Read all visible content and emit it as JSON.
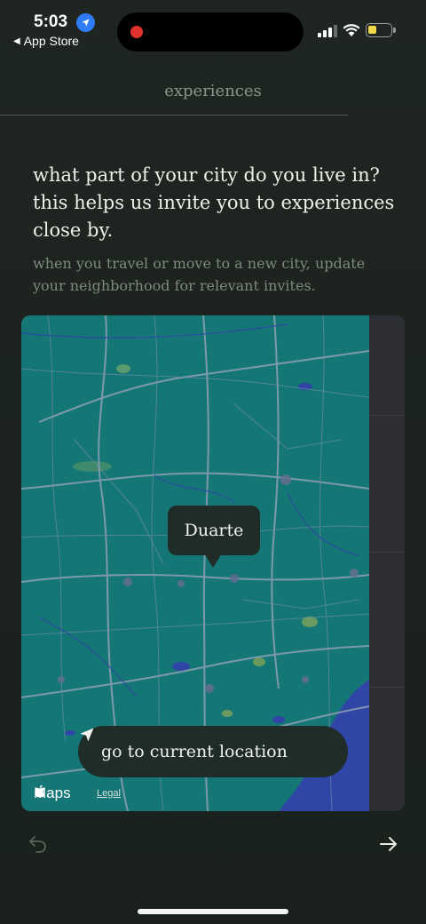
{
  "status_bar": {
    "time": "5:03",
    "back_label": "App Store"
  },
  "header": {
    "title": "experiences"
  },
  "content": {
    "question": "what part of your city do you live in? this helps us invite you to experiences close by.",
    "subtext": "when you travel or move to a new city, update your neighborhood for relevant invites."
  },
  "map": {
    "pin_label": "Duarte",
    "location_button_label": "go to current location",
    "maps_brand": "Maps",
    "legal_label": "Legal",
    "land_color": "#147775",
    "water_color": "#2f46a6"
  },
  "footer": {
    "back_icon": "undo-arrow-icon",
    "next_icon": "arrow-right-icon"
  }
}
